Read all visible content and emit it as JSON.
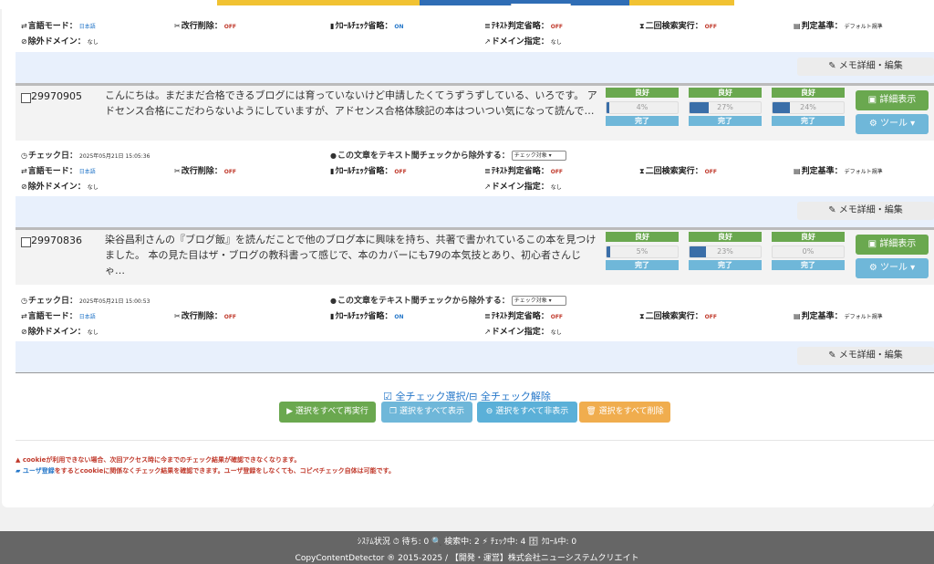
{
  "rows_top": {
    "info": [
      {
        "label": "言語モード：",
        "value": "日本語",
        "vclass": "blue"
      },
      {
        "label": "改行削除：",
        "value": "OFF",
        "vclass": "off"
      },
      {
        "label": "ｸﾛｰﾙﾁｪｯｸ省略：",
        "value": "ON",
        "vclass": "on"
      },
      {
        "label": "ﾃｷｽﾄ判定省略：",
        "value": "OFF",
        "vclass": "off"
      },
      {
        "label": "二回検索実行：",
        "value": "OFF",
        "vclass": "off"
      },
      {
        "label": "判定基準：",
        "value": "デフォルト規準",
        "vclass": ""
      }
    ],
    "exclude": {
      "label": "除外ドメイン：",
      "value": "なし"
    },
    "domain": {
      "label": "ドメイン指定：",
      "value": "なし"
    }
  },
  "memo_button": "メモ詳細・編集",
  "entries": [
    {
      "id": "29970905",
      "excerpt": "こんにちは。まだまだ合格できるブログには育っていないけど申請したくてうずうずしている、いろです。 アドセンス合格にこだわらないようにしていますが、アドセンス合格体験記の本はついつい気になって読んで…",
      "stats": [
        {
          "label": "良好",
          "progress": 4,
          "text": "4%",
          "done": "完了"
        },
        {
          "label": "良好",
          "progress": 27,
          "text": "27%",
          "done": "完了"
        },
        {
          "label": "良好",
          "progress": 24,
          "text": "24%",
          "done": "完了"
        }
      ],
      "detail_button": "詳細表示",
      "tool_button": "ツール",
      "check_date_label": "チェック日：",
      "check_date": "2025年05月21日 15:05:36",
      "exclude_label": "この文章をテキスト間チェックから除外する：",
      "exclude_select": "チェック対象",
      "info": [
        {
          "label": "言語モード：",
          "value": "日本語",
          "vclass": "blue"
        },
        {
          "label": "改行削除：",
          "value": "OFF",
          "vclass": "off"
        },
        {
          "label": "ｸﾛｰﾙﾁｪｯｸ省略：",
          "value": "OFF",
          "vclass": "off"
        },
        {
          "label": "ﾃｷｽﾄ判定省略：",
          "value": "OFF",
          "vclass": "off"
        },
        {
          "label": "二回検索実行：",
          "value": "OFF",
          "vclass": "off"
        },
        {
          "label": "判定基準：",
          "value": "デフォルト規準",
          "vclass": ""
        }
      ],
      "exclude_domain_label": "除外ドメイン：",
      "exclude_domain": "なし",
      "domain_label": "ドメイン指定：",
      "domain": "なし"
    },
    {
      "id": "29970836",
      "excerpt": "染谷昌利さんの『ブログ飯』を読んだことで他のブログ本に興味を持ち、共著で書かれているこの本を見つけました。 本の見た目はザ・ブログの教科書って感じで、本のカバーにも79の本気技とあり、初心者さんじゃ…",
      "stats": [
        {
          "label": "良好",
          "progress": 5,
          "text": "5%",
          "done": "完了"
        },
        {
          "label": "良好",
          "progress": 23,
          "text": "23%",
          "done": "完了"
        },
        {
          "label": "良好",
          "progress": 0,
          "text": "0%",
          "done": "完了"
        }
      ],
      "detail_button": "詳細表示",
      "tool_button": "ツール",
      "check_date_label": "チェック日：",
      "check_date": "2025年05月21日 15:00:53",
      "exclude_label": "この文章をテキスト間チェックから除外する：",
      "exclude_select": "チェック対象",
      "info": [
        {
          "label": "言語モード：",
          "value": "日本語",
          "vclass": "blue"
        },
        {
          "label": "改行削除：",
          "value": "OFF",
          "vclass": "off"
        },
        {
          "label": "ｸﾛｰﾙﾁｪｯｸ省略：",
          "value": "ON",
          "vclass": "on"
        },
        {
          "label": "ﾃｷｽﾄ判定省略：",
          "value": "OFF",
          "vclass": "off"
        },
        {
          "label": "二回検索実行：",
          "value": "OFF",
          "vclass": "off"
        },
        {
          "label": "判定基準：",
          "value": "デフォルト規準",
          "vclass": ""
        }
      ],
      "exclude_domain_label": "除外ドメイン：",
      "exclude_domain": "なし",
      "domain_label": "ドメイン指定：",
      "domain": "なし"
    }
  ],
  "select_all": "全チェック選択",
  "select_sep": "/",
  "deselect_all": "全チェック解除",
  "actions": [
    {
      "label": "選択をすべて再実行",
      "color": "#6aa84f"
    },
    {
      "label": "選択をすべて表示",
      "color": "#6fb7d9"
    },
    {
      "label": "選択をすべて非表示",
      "color": "#5bb0d8"
    },
    {
      "label": "選択をすべて削除",
      "color": "#f0ad4e"
    }
  ],
  "notes": {
    "warning": "cookieが利用できない場合、次回アクセス時に今までのチェック結果が確認できなくなります。",
    "register_link": "ユーザ登録",
    "register_rest": "をするとcookieに関係なくチェック結果を確認できます。ユーザ登録をしなくても、コピペチェック自体は可能です。"
  },
  "footer": {
    "status": "ｼｽﾃﾑ状況 ⏱ 待ち: 0 🔍 検索中: 2 ⚡ ﾁｪｯｸ中: 4 🗄 ｸﾛｰﾙ中: 0",
    "copyright": "CopyContentDetector ® 2015-2025 / 【開発・運営】株式会社ニューシステムクリエイト"
  },
  "colors": {
    "good": "#6aa84f",
    "done": "#6fb7d9",
    "bar": "#3a6ea8",
    "memo_bg": "#e8f0fc"
  }
}
